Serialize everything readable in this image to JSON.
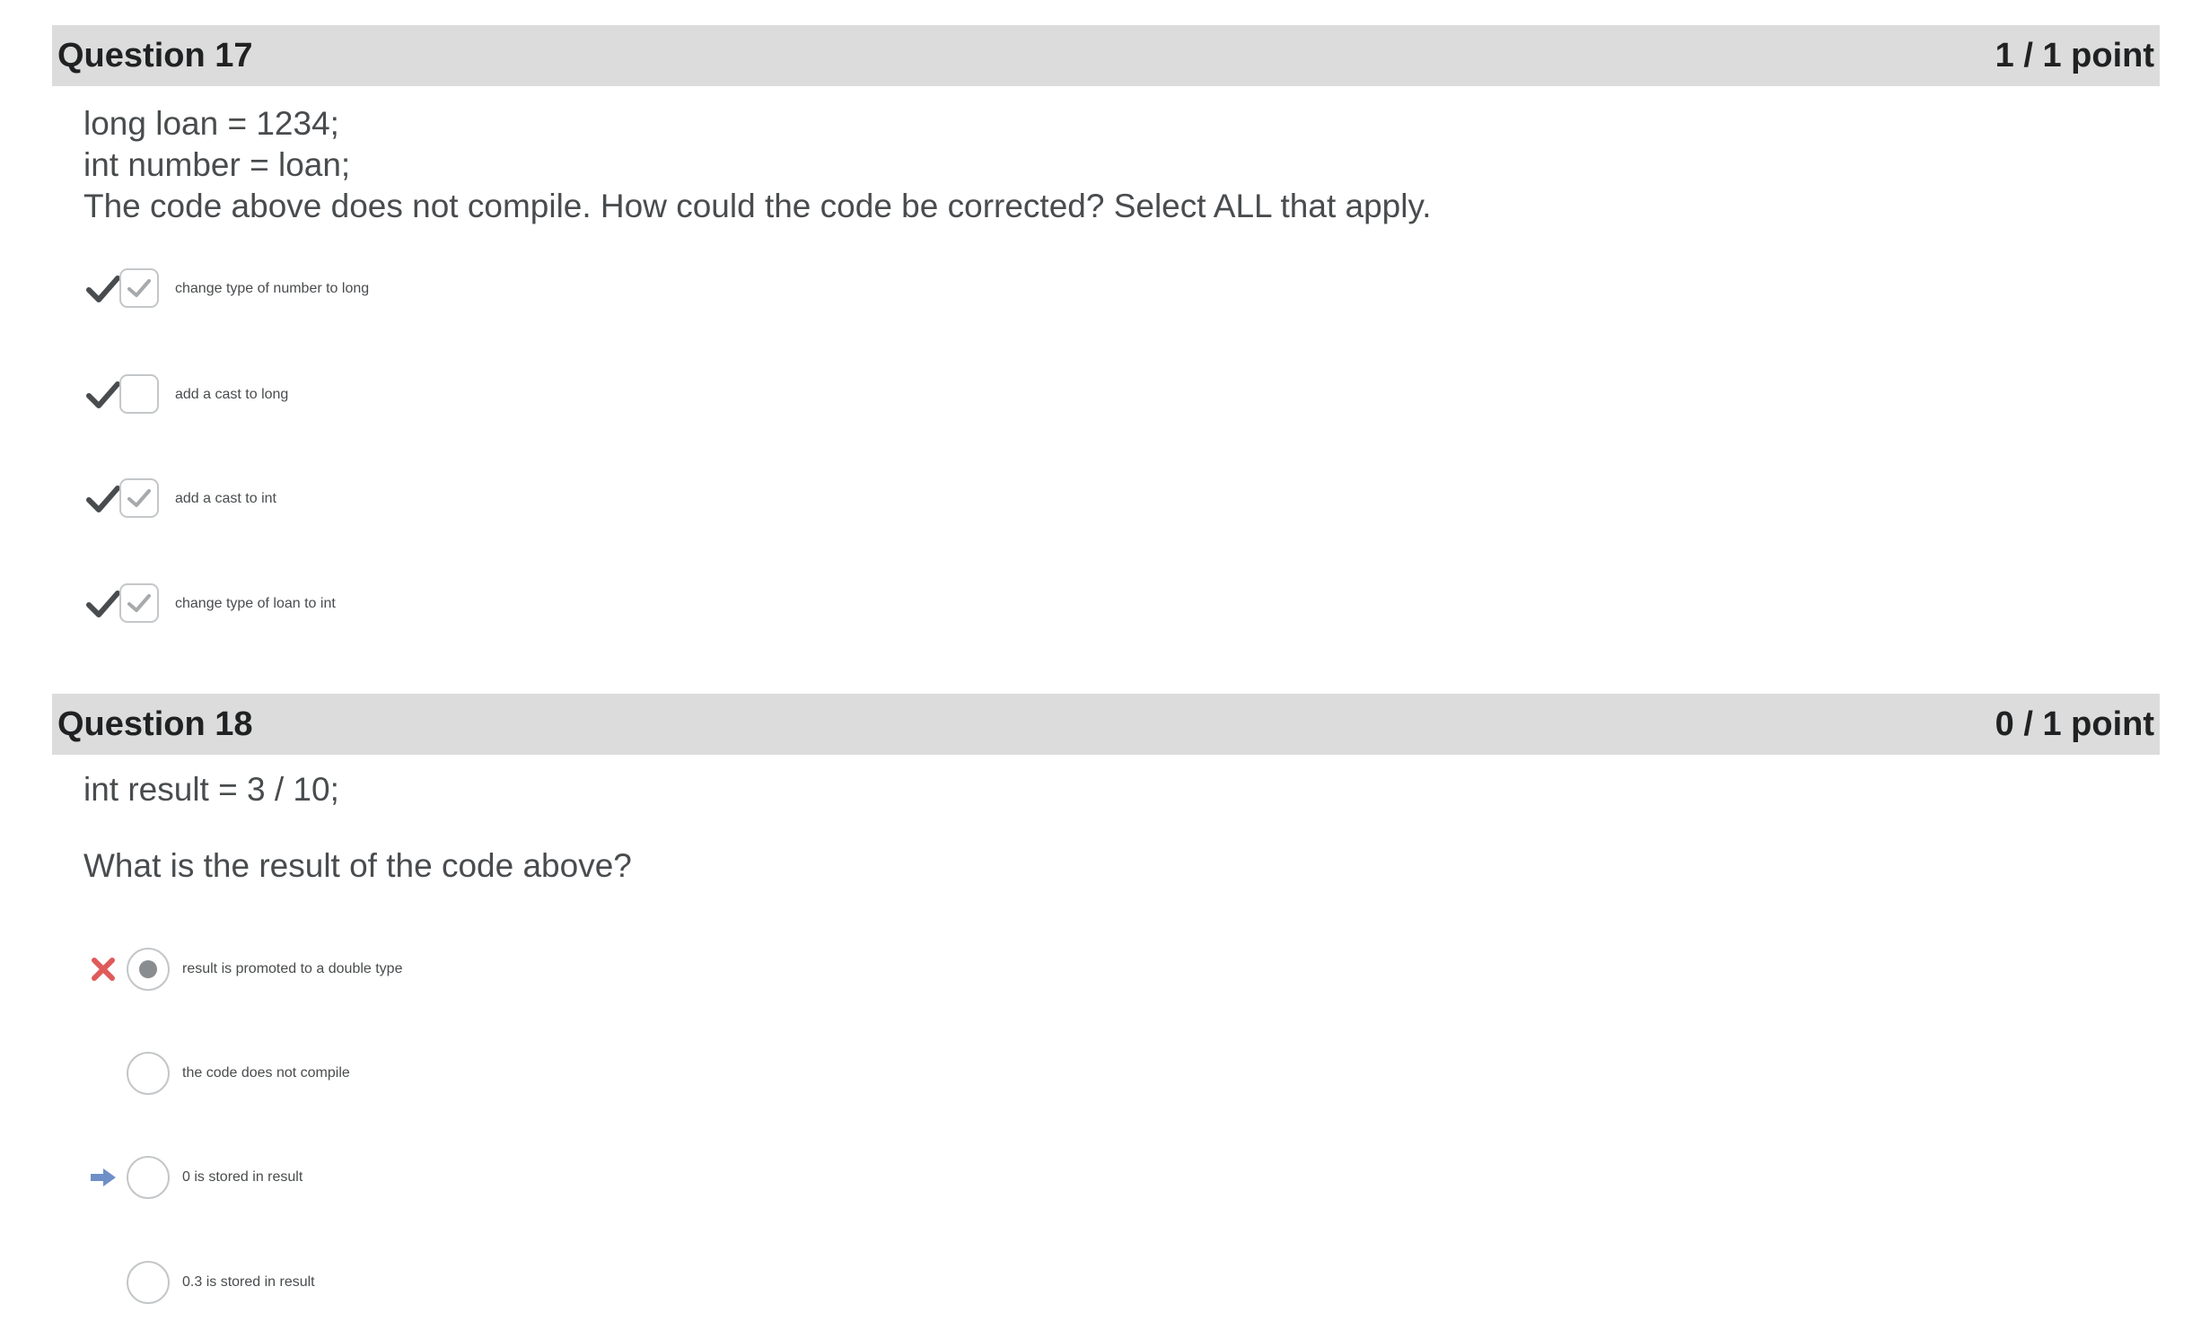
{
  "questions": [
    {
      "title": "Question 17",
      "score": "1 / 1 point",
      "prompt": [
        "long loan = 1234;",
        "int number = loan;",
        "The code above does not compile. How could the code be corrected? Select ALL that apply."
      ],
      "options": [
        {
          "label": "change type of number to long",
          "checked": true,
          "indicator": "check-icon"
        },
        {
          "label": "add a cast to long",
          "checked": false,
          "indicator": "check-icon"
        },
        {
          "label": "add a cast to int",
          "checked": true,
          "indicator": "check-icon"
        },
        {
          "label": "change type of loan to int",
          "checked": true,
          "indicator": "check-icon"
        }
      ]
    },
    {
      "title": "Question 18",
      "score": "0 / 1 point",
      "prompt": [
        "int result = 3 / 10;",
        "What is the result of the code above?"
      ],
      "options": [
        {
          "label": "result is promoted to a double type",
          "selected": true,
          "indicator": "cross-icon"
        },
        {
          "label": "the code does not compile",
          "selected": false,
          "indicator": ""
        },
        {
          "label": "0 is stored in result",
          "selected": false,
          "indicator": "arrow-right-icon"
        },
        {
          "label": "0.3 is stored in result",
          "selected": false,
          "indicator": ""
        }
      ]
    }
  ],
  "colors": {
    "header_bg": "#dcdcdc",
    "correct_check": "#494c4e",
    "incorrect_cross": "#e05a5a",
    "answer_arrow": "#6f8fc8",
    "box_border": "#c4c7c9"
  }
}
